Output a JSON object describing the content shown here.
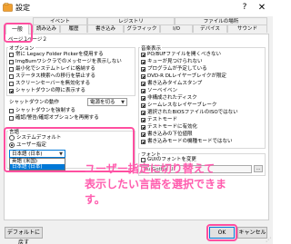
{
  "window": {
    "title": "設定",
    "help_glyph": "?",
    "close_glyph": "✕"
  },
  "tabs_top": [
    "イベント",
    "レジストリ",
    "ファイルの場所"
  ],
  "tabs_main": [
    "一般",
    "読み込み",
    "履歴",
    "書き込み",
    "グラフィック",
    "I/O",
    "デバイス",
    "サウンド"
  ],
  "subtabs": [
    "ページ１",
    "ページ２"
  ],
  "options_group": {
    "title": "オプション",
    "items": [
      {
        "label": "常に Legacy Folder Pickerを使用する",
        "checked": false
      },
      {
        "label": "ImgBurnワシクラでのメッセージを表示しない",
        "checked": false
      },
      {
        "label": "最小化でシステムトレイに格納する",
        "checked": false
      },
      {
        "label": "ステータス検索への移行を禁止する",
        "checked": false
      },
      {
        "label": "スクリーンセーバーを無効化する",
        "checked": false
      },
      {
        "label": "シャットダウンの際に表示する",
        "checked": true
      }
    ]
  },
  "shutdown": {
    "label": "シャットダウンの動作",
    "value": "電源を切る",
    "force_label": "シャットダウンを強制する",
    "force_checked": false
  },
  "misc": {
    "label": "確認/警告/確認オプションを再開する",
    "checked": false
  },
  "language_group": {
    "title": "言語",
    "radio_system": "システムデフォルト",
    "radio_user": "ユーザー指定",
    "selected_value": "日本語 (日本)",
    "options": [
      "英語 (米国)",
      "日本語 (日本)"
    ]
  },
  "sound_group": {
    "title": "音楽表示",
    "items": [
      {
        "label": "PO/BUFファイルを開くべきない",
        "checked": true
      },
      {
        "label": "キューが見つけられない",
        "checked": true
      },
      {
        "label": "プログラムが予定している",
        "checked": true
      },
      {
        "label": "DVD-R DLレイヤーブレイクが限定",
        "checked": true
      },
      {
        "label": "書き込みタイムスタンプ",
        "checked": true
      },
      {
        "label": "ソーベイベン",
        "checked": true
      },
      {
        "label": "非構成されたディスク",
        "checked": true
      },
      {
        "label": "シームレスなレイヤーブレーク",
        "checked": true
      },
      {
        "label": "選択されたBIOSファイルのISOではない",
        "checked": true
      },
      {
        "label": "テストモード",
        "checked": true
      },
      {
        "label": "テストモードに有効化",
        "checked": true
      },
      {
        "label": "書き込みの下位値限",
        "checked": true
      },
      {
        "label": "書き込みモードの機種モードではない",
        "checked": true
      }
    ]
  },
  "font_group": {
    "title": "フォント",
    "checkbox_label": "GUIのフォントを変更",
    "field_value": "Yu Gothic UI",
    "button_glyph": "..."
  },
  "annotation": {
    "line1": "ユーザー指定に切り替えて",
    "line2": "表示したい言語を選択できます。"
  },
  "buttons": {
    "default": "デフォルトに戻す",
    "ok": "OK",
    "cancel": "キャンセル"
  },
  "colors": {
    "highlight": "#ff4fa0",
    "selection": "#0078d7",
    "annotation_text": "#ff5cae"
  }
}
